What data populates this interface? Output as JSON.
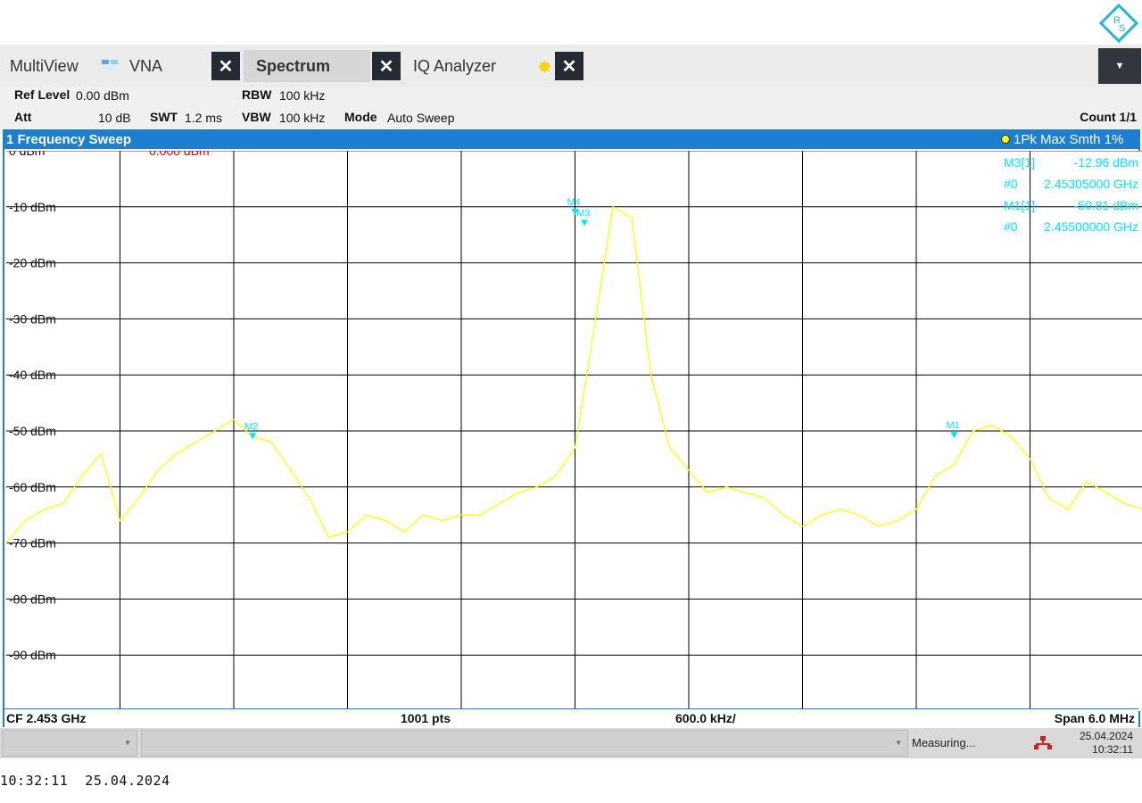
{
  "tabs": {
    "multiview": "MultiView",
    "vna": "VNA",
    "spectrum": "Spectrum",
    "iq": "IQ Analyzer"
  },
  "settings": {
    "ref_level_label": "Ref Level",
    "ref_level_value": "0.00 dBm",
    "att_label": "Att",
    "att_value": "10 dB",
    "swt_label": "SWT",
    "swt_value": "1.2 ms",
    "rbw_label": "RBW",
    "rbw_value": "100 kHz",
    "vbw_label": "VBW",
    "vbw_value": "100 kHz",
    "mode_label": "Mode",
    "mode_value": "Auto Sweep",
    "count": "Count 1/1"
  },
  "window": {
    "title": "1 Frequency Sweep",
    "trace_label": "1Pk Max Smth 1%",
    "ref_line_label": "0.000 dBm"
  },
  "marker_table": [
    {
      "name": "M3[1]",
      "value": "-12.96 dBm"
    },
    {
      "name": "#0",
      "value": "2.45305000 GHz"
    },
    {
      "name": "M1[1]",
      "value": "-50.81 dBm"
    },
    {
      "name": "#0",
      "value": "2.45500000 GHz"
    }
  ],
  "footer": {
    "cf": "CF 2.453 GHz",
    "pts": "1001 pts",
    "div": "600.0 kHz/",
    "span": "Span 6.0 MHz"
  },
  "status": {
    "measuring": "Measuring...",
    "date": "25.04.2024",
    "time": "10:32:11"
  },
  "bottom_timestamp": "10:32:11  25.04.2024",
  "colors": {
    "trace": "#ffff00",
    "marker": "#00e5ff",
    "ref_line": "#cc0000",
    "window_border": "#1e7fd0"
  },
  "chart_data": {
    "type": "line",
    "title": "1 Frequency Sweep",
    "xlabel": "",
    "ylabel": "",
    "x_start_ghz": 2.45,
    "x_stop_ghz": 2.456,
    "ylim": [
      -100,
      0
    ],
    "y_ticks": [
      "0 dBm",
      "-10 dBm",
      "-20 dBm",
      "-30 dBm",
      "-40 dBm",
      "-50 dBm",
      "-60 dBm",
      "-70 dBm",
      "-80 dBm",
      "-90 dBm"
    ],
    "grid": true,
    "series": [
      {
        "name": "1Pk Max Smth 1%",
        "x": [
          2.45,
          2.4501,
          2.4502,
          2.4503,
          2.4504,
          2.4505,
          2.4506,
          2.4507,
          2.4508,
          2.4509,
          2.451,
          2.4511,
          2.4512,
          2.4513,
          2.4514,
          2.4515,
          2.4516,
          2.4517,
          2.4518,
          2.4519,
          2.452,
          2.4521,
          2.4522,
          2.4523,
          2.4524,
          2.4525,
          2.4526,
          2.4527,
          2.4528,
          2.4529,
          2.453,
          2.4531,
          2.4532,
          2.4533,
          2.4534,
          2.4535,
          2.4536,
          2.4537,
          2.4538,
          2.4539,
          2.454,
          2.4541,
          2.4542,
          2.4543,
          2.4544,
          2.4545,
          2.4546,
          2.4547,
          2.4548,
          2.4549,
          2.455,
          2.4551,
          2.4552,
          2.4553,
          2.4554,
          2.4555,
          2.4556,
          2.4557,
          2.4558,
          2.4559,
          2.456
        ],
        "y": [
          -70,
          -66,
          -64,
          -63,
          -58,
          -54,
          -66,
          -62,
          -57,
          -54,
          -52,
          -50,
          -48,
          -51,
          -52,
          -57,
          -62,
          -69,
          -68,
          -65,
          -66,
          -68,
          -65,
          -66,
          -65,
          -65,
          -63,
          -61,
          -60,
          -58,
          -53,
          -32,
          -10,
          -12,
          -40,
          -53,
          -57,
          -61,
          -60,
          -61,
          -62,
          -65,
          -67,
          -65,
          -64,
          -65,
          -67,
          -66,
          -64,
          -58,
          -56,
          -50,
          -49,
          -51,
          -55,
          -62,
          -64,
          -59,
          -61,
          -63,
          -64
        ]
      }
    ],
    "markers": [
      {
        "name": "M1",
        "x": 2.455,
        "y": -50.81
      },
      {
        "name": "M2",
        "x": 2.4513,
        "y": -51
      },
      {
        "name": "M3",
        "x": 2.45305,
        "y": -12.96
      },
      {
        "name": "M4",
        "x": 2.453,
        "y": -11
      }
    ]
  }
}
